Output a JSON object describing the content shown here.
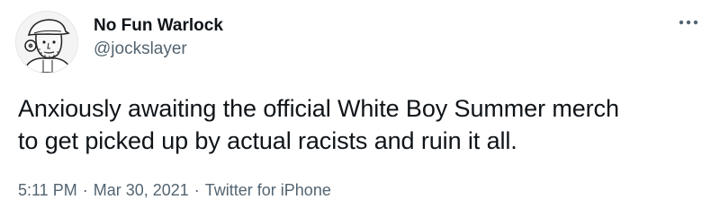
{
  "author": {
    "display_name": "No Fun Warlock",
    "handle": "@jockslayer"
  },
  "tweet": {
    "text_line_1": "Anxiously awaiting the official White Boy Summer merch",
    "text_line_2": "to get picked up by actual racists and ruin it all."
  },
  "meta": {
    "time": "5:11 PM",
    "separator": "·",
    "date": "Mar 30, 2021",
    "source": "Twitter for iPhone"
  },
  "icons": {
    "avatar": "illustrated-portrait-avatar",
    "more": "more-dots-icon"
  },
  "colors": {
    "text_primary": "#0f1419",
    "text_secondary": "#536471",
    "background": "#ffffff"
  }
}
